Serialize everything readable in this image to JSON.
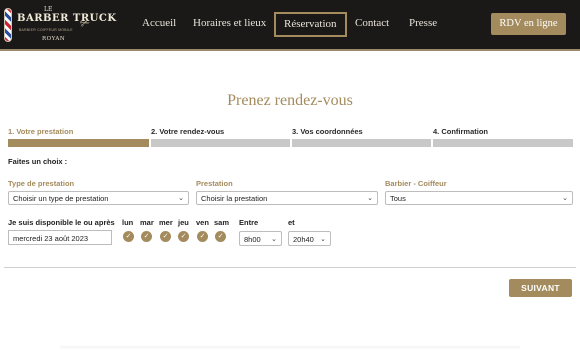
{
  "logo": {
    "le": "LE",
    "name": "BARBER TRUCK",
    "tagline": "BARBIER COIFFEUR MOBILE",
    "city": "ROYAN"
  },
  "nav": {
    "home": "Accueil",
    "hours": "Horaires et lieux",
    "booking": "Réservation",
    "contact": "Contact",
    "press": "Presse",
    "cta": "RDV en ligne"
  },
  "page": {
    "title": "Prenez rendez-vous"
  },
  "steps": [
    "1. Votre prestation",
    "2. Votre rendez-vous",
    "3. Vos coordonnées",
    "4. Confirmation"
  ],
  "active_step": 1,
  "form": {
    "choice_label": "Faites un choix :",
    "type_label": "Type de prestation",
    "type_value": "Choisir un type de prestation",
    "service_label": "Prestation",
    "service_value": "Choisir la prestation",
    "barber_label": "Barbier - Coiffeur",
    "barber_value": "Tous",
    "date_label": "Je suis disponible le ou après",
    "date_value": "mercredi 23 août 2023",
    "days": [
      "lun",
      "mar",
      "mer",
      "jeu",
      "ven",
      "sam"
    ],
    "from_label": "Entre",
    "from_value": "8h00",
    "to_label": "et",
    "to_value": "20h40",
    "next_button": "SUIVANT"
  },
  "colors": {
    "accent": "#a38b5d",
    "header_bg": "#1b1918",
    "step_inactive": "#c8c8c8"
  }
}
